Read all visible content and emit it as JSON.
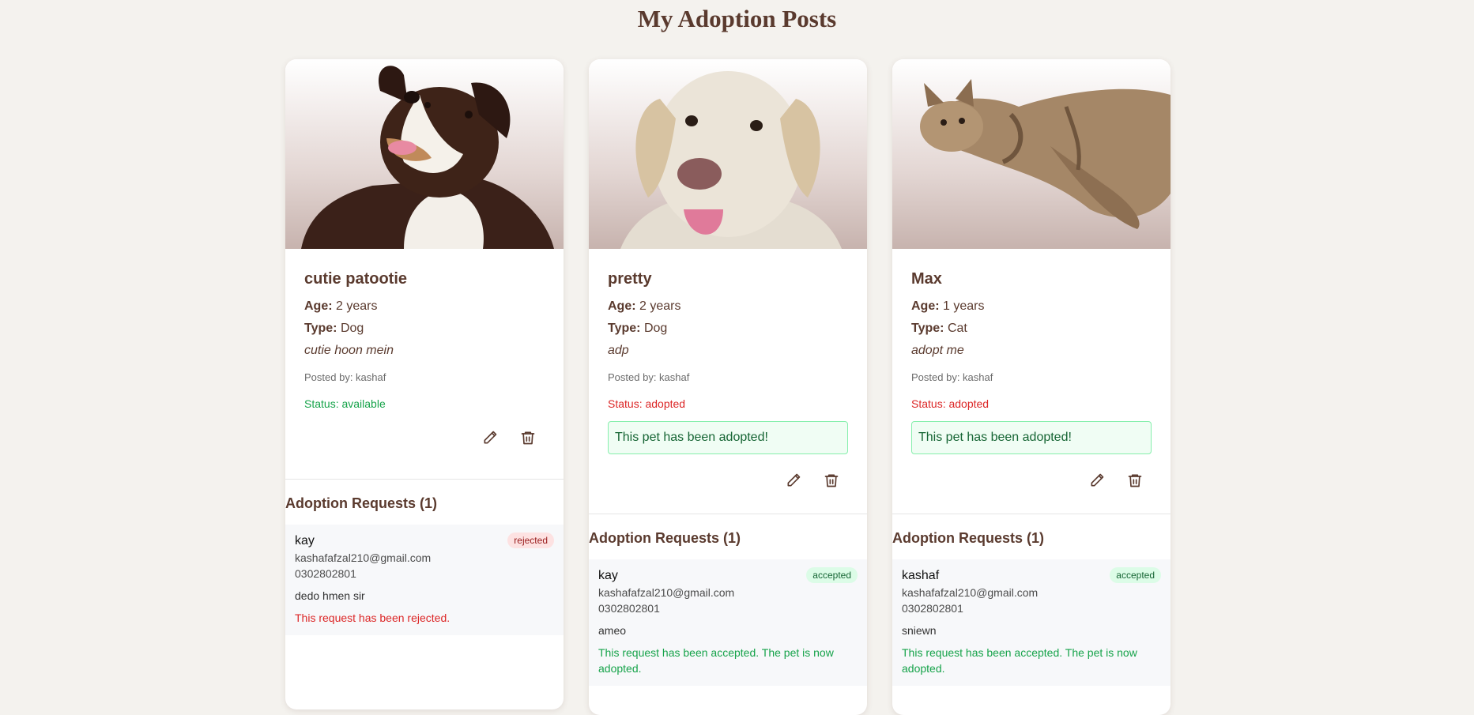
{
  "page": {
    "title": "My Adoption Posts"
  },
  "labels": {
    "age": "Age:",
    "type": "Type:",
    "adopted_notice": "This pet has been adopted!",
    "requests_title": "Adoption Requests (1)"
  },
  "colors": {
    "brand_brown": "#5a3a2e",
    "available": "#16a34a",
    "adopted": "#dc2626",
    "page_bg": "#f4f2ee"
  },
  "posts": [
    {
      "name": "cutie patootie",
      "age": "2 years",
      "type": "Dog",
      "description": "cutie hoon mein",
      "posted_by": "Posted by: kashaf",
      "status": "Status: available",
      "photo_subject": "tricolor dog",
      "request": {
        "name": "kay",
        "email": "kashafafzal210@gmail.com",
        "phone": "0302802801",
        "message": "dedo hmen sir",
        "badge": "rejected",
        "note": "This request has been rejected."
      }
    },
    {
      "name": "pretty",
      "age": "2 years",
      "type": "Dog",
      "description": "adp",
      "posted_by": "Posted by: kashaf",
      "status": "Status: adopted",
      "photo_subject": "labrador dog",
      "request": {
        "name": "kay",
        "email": "kashafafzal210@gmail.com",
        "phone": "0302802801",
        "message": "ameo",
        "badge": "accepted",
        "note": "This request has been accepted. The pet is now adopted."
      }
    },
    {
      "name": "Max",
      "age": "1 years",
      "type": "Cat",
      "description": "adopt me",
      "posted_by": "Posted by: kashaf",
      "status": "Status: adopted",
      "photo_subject": "tabby cat",
      "request": {
        "name": "kashaf",
        "email": "kashafafzal210@gmail.com",
        "phone": "0302802801",
        "message": "sniewn",
        "badge": "accepted",
        "note": "This request has been accepted. The pet is now adopted."
      }
    }
  ]
}
